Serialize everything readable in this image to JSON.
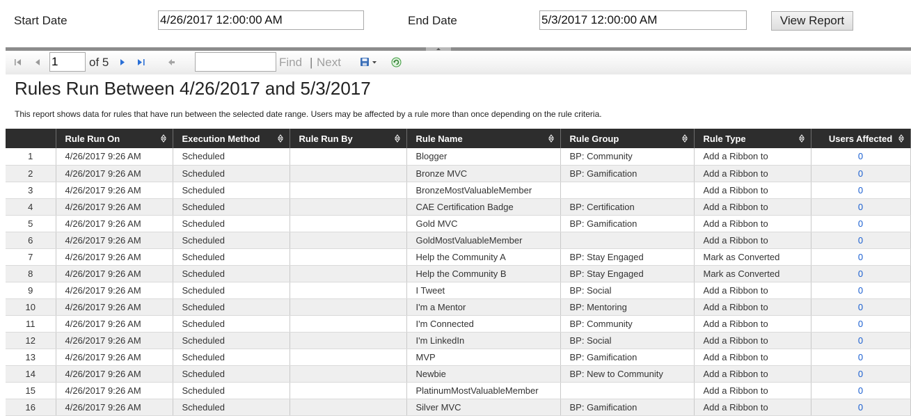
{
  "params": {
    "start_label": "Start Date",
    "start_value": "4/26/2017 12:00:00 AM",
    "end_label": "End Date",
    "end_value": "5/3/2017 12:00:00 AM",
    "view_button": "View Report"
  },
  "toolbar": {
    "page_value": "1",
    "of_label": "of 5",
    "find_label": "Find",
    "separator": "|",
    "next_label": "Next",
    "icons": [
      "first-page-icon",
      "previous-page-icon",
      "next-page-icon",
      "last-page-icon",
      "back-to-parent-icon",
      "export-save-icon",
      "refresh-icon"
    ]
  },
  "report": {
    "title": "Rules Run Between 4/26/2017 and 5/3/2017",
    "description": "This report shows data for rules that have run between the selected date range.  Users may be affected by a rule more than once depending on the rule criteria."
  },
  "table": {
    "columns": [
      "",
      "Rule Run On",
      "Execution Method",
      "Rule Run By",
      "Rule Name",
      "Rule Group",
      "Rule Type",
      "Users Affected"
    ],
    "rows": [
      {
        "n": "1",
        "run_on": "4/26/2017 9:26 AM",
        "method": "Scheduled",
        "run_by": "",
        "name": "Blogger",
        "group": "BP: Community",
        "type": "Add a Ribbon to",
        "affected": "0"
      },
      {
        "n": "2",
        "run_on": "4/26/2017 9:26 AM",
        "method": "Scheduled",
        "run_by": "",
        "name": "Bronze MVC",
        "group": "BP: Gamification",
        "type": "Add a Ribbon to",
        "affected": "0"
      },
      {
        "n": "3",
        "run_on": "4/26/2017 9:26 AM",
        "method": "Scheduled",
        "run_by": "",
        "name": "BronzeMostValuableMember",
        "group": "",
        "type": "Add a Ribbon to",
        "affected": "0"
      },
      {
        "n": "4",
        "run_on": "4/26/2017 9:26 AM",
        "method": "Scheduled",
        "run_by": "",
        "name": "CAE Certification Badge",
        "group": "BP: Certification",
        "type": "Add a Ribbon to",
        "affected": "0"
      },
      {
        "n": "5",
        "run_on": "4/26/2017 9:26 AM",
        "method": "Scheduled",
        "run_by": "",
        "name": "Gold MVC",
        "group": "BP: Gamification",
        "type": "Add a Ribbon to",
        "affected": "0"
      },
      {
        "n": "6",
        "run_on": "4/26/2017 9:26 AM",
        "method": "Scheduled",
        "run_by": "",
        "name": "GoldMostValuableMember",
        "group": "",
        "type": "Add a Ribbon to",
        "affected": "0"
      },
      {
        "n": "7",
        "run_on": "4/26/2017 9:26 AM",
        "method": "Scheduled",
        "run_by": "",
        "name": "Help the Community A",
        "group": "BP: Stay Engaged",
        "type": "Mark as Converted",
        "affected": "0"
      },
      {
        "n": "8",
        "run_on": "4/26/2017 9:26 AM",
        "method": "Scheduled",
        "run_by": "",
        "name": "Help the Community B",
        "group": "BP: Stay Engaged",
        "type": "Mark as Converted",
        "affected": "0"
      },
      {
        "n": "9",
        "run_on": "4/26/2017 9:26 AM",
        "method": "Scheduled",
        "run_by": "",
        "name": "I Tweet",
        "group": "BP: Social",
        "type": "Add a Ribbon to",
        "affected": "0"
      },
      {
        "n": "10",
        "run_on": "4/26/2017 9:26 AM",
        "method": "Scheduled",
        "run_by": "",
        "name": "I'm a Mentor",
        "group": "BP: Mentoring",
        "type": "Add a Ribbon to",
        "affected": "0"
      },
      {
        "n": "11",
        "run_on": "4/26/2017 9:26 AM",
        "method": "Scheduled",
        "run_by": "",
        "name": "I'm Connected",
        "group": "BP: Community",
        "type": "Add a Ribbon to",
        "affected": "0"
      },
      {
        "n": "12",
        "run_on": "4/26/2017 9:26 AM",
        "method": "Scheduled",
        "run_by": "",
        "name": "I'm LinkedIn",
        "group": "BP: Social",
        "type": "Add a Ribbon to",
        "affected": "0"
      },
      {
        "n": "13",
        "run_on": "4/26/2017 9:26 AM",
        "method": "Scheduled",
        "run_by": "",
        "name": "MVP",
        "group": "BP: Gamification",
        "type": "Add a Ribbon to",
        "affected": "0"
      },
      {
        "n": "14",
        "run_on": "4/26/2017 9:26 AM",
        "method": "Scheduled",
        "run_by": "",
        "name": "Newbie",
        "group": "BP: New to Community",
        "type": "Add a Ribbon to",
        "affected": "0"
      },
      {
        "n": "15",
        "run_on": "4/26/2017 9:26 AM",
        "method": "Scheduled",
        "run_by": "",
        "name": "PlatinumMostValuableMember",
        "group": "",
        "type": "Add a Ribbon to",
        "affected": "0"
      },
      {
        "n": "16",
        "run_on": "4/26/2017 9:26 AM",
        "method": "Scheduled",
        "run_by": "",
        "name": "Silver MVC",
        "group": "BP: Gamification",
        "type": "Add a Ribbon to",
        "affected": "0"
      }
    ]
  }
}
